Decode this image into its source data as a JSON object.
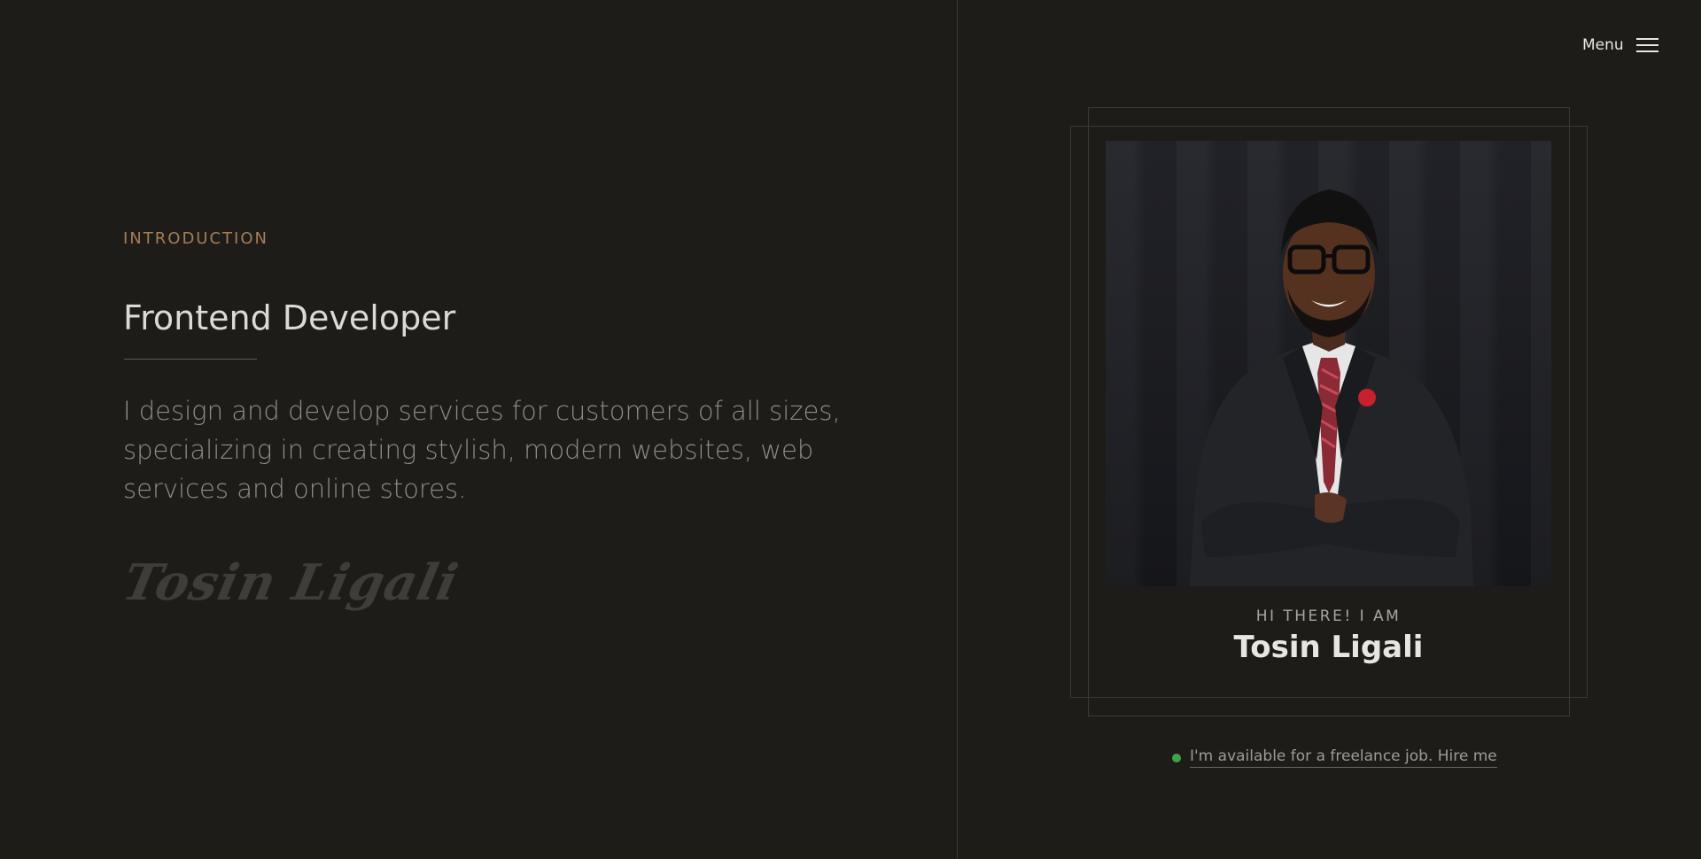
{
  "intro": {
    "eyebrow": "INTRODUCTION",
    "role": "Frontend Developer",
    "bio": "I design and develop services for customers of all sizes, specializing in creating stylish, modern websites, web services and online stores.",
    "signature": "Tosin Ligali"
  },
  "menu": {
    "label": "Menu",
    "icon": "hamburger-icon"
  },
  "card": {
    "greeting": "HI THERE! I AM",
    "name": "Tosin Ligali"
  },
  "availability": {
    "text": "I'm available for a freelance job. Hire me",
    "status_color": "#3fa34d"
  },
  "colors": {
    "background": "#1e1c19",
    "accent": "#a57d52"
  }
}
